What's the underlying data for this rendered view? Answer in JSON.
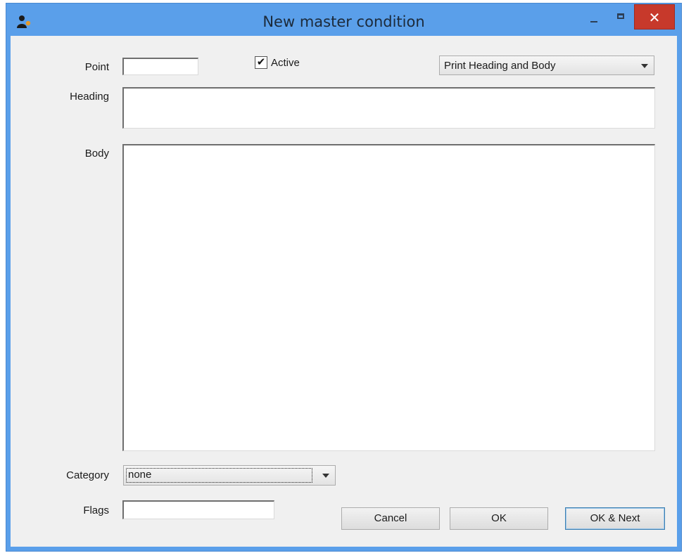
{
  "window": {
    "title": "New master condition",
    "close_glyph": "✕",
    "icon": "user-app-icon"
  },
  "form": {
    "point": {
      "label": "Point",
      "value": ""
    },
    "active": {
      "label": "Active",
      "checked": true,
      "check_glyph": "✔"
    },
    "print_mode": {
      "selected": "Print Heading and Body"
    },
    "heading": {
      "label": "Heading",
      "value": ""
    },
    "body": {
      "label": "Body",
      "value": ""
    },
    "category": {
      "label": "Category",
      "selected": "none"
    },
    "flags": {
      "label": "Flags",
      "value": ""
    }
  },
  "buttons": {
    "cancel": "Cancel",
    "ok": "OK",
    "ok_next": "OK & Next"
  },
  "colors": {
    "titlebar": "#5a9fea",
    "close_button": "#c7392b",
    "client_background": "#f0f0f0"
  }
}
